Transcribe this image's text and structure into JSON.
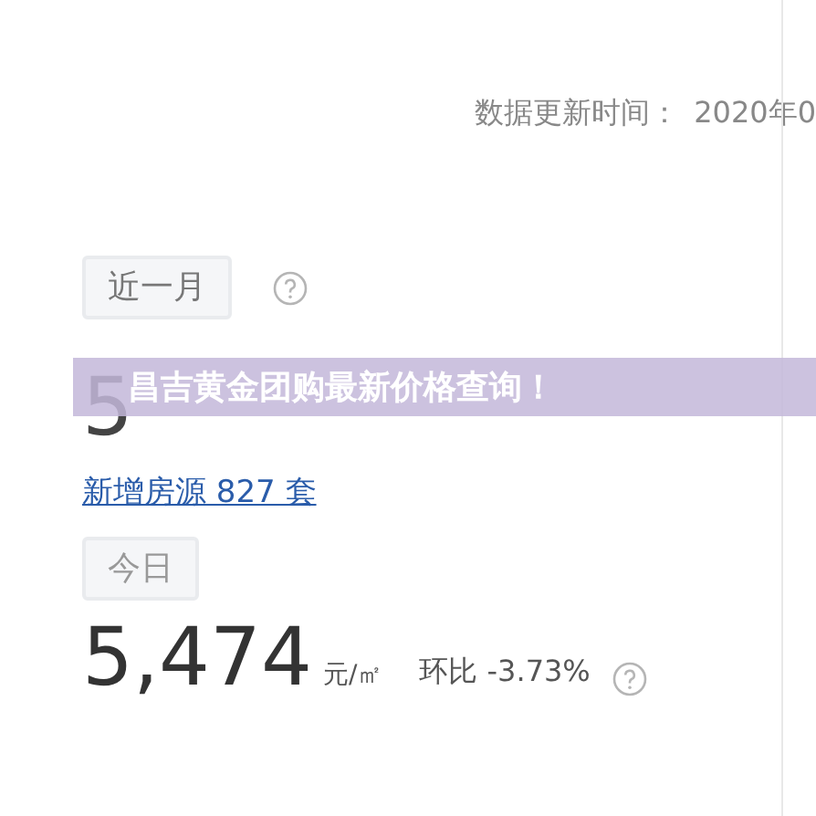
{
  "update_time": {
    "label": "数据更新时间：",
    "value": "2020年0"
  },
  "month": {
    "range_button": "近一月",
    "price_first_digit": "5",
    "new_listings": "新增房源 827 套"
  },
  "banner": {
    "text": "昌吉黄金团购最新价格查询！"
  },
  "today": {
    "range_button": "今日",
    "price": "5,474",
    "unit": "元/㎡",
    "change": "环比 -3.73%"
  }
}
